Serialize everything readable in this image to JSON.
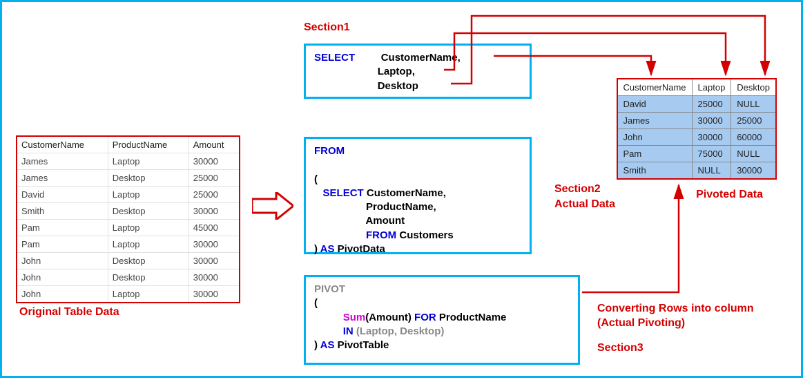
{
  "labels": {
    "section1": "Section1",
    "section2a": "Section2",
    "section2b": "Actual Data",
    "section3_line1": "Converting Rows into column",
    "section3_line2": "(Actual Pivoting)",
    "section3": "Section3",
    "original": "Original Table Data",
    "pivoted": "Pivoted Data"
  },
  "source_table": {
    "headers": [
      "CustomerName",
      "ProductName",
      "Amount"
    ],
    "rows": [
      [
        "James",
        "Laptop",
        "30000"
      ],
      [
        "James",
        "Desktop",
        "25000"
      ],
      [
        "David",
        "Laptop",
        "25000"
      ],
      [
        "Smith",
        "Desktop",
        "30000"
      ],
      [
        "Pam",
        "Laptop",
        "45000"
      ],
      [
        "Pam",
        "Laptop",
        "30000"
      ],
      [
        "John",
        "Desktop",
        "30000"
      ],
      [
        "John",
        "Desktop",
        "30000"
      ],
      [
        "John",
        "Laptop",
        "30000"
      ]
    ]
  },
  "pivot_table": {
    "headers": [
      "CustomerName",
      "Laptop",
      "Desktop"
    ],
    "rows": [
      [
        "David",
        "25000",
        "NULL"
      ],
      [
        "James",
        "30000",
        "25000"
      ],
      [
        "John",
        "30000",
        "60000"
      ],
      [
        "Pam",
        "75000",
        "NULL"
      ],
      [
        "Smith",
        "NULL",
        "30000"
      ]
    ]
  },
  "code": {
    "box1": {
      "keyword": "SELECT",
      "col1": "CustomerName",
      "col2": "Laptop",
      "col3": "Desktop"
    },
    "box2": {
      "from": "FROM",
      "open": "(",
      "select": "SELECT",
      "c1": "CustomerName",
      "c2": "ProductName",
      "c3": "Amount",
      "from2": "FROM",
      "tbl": "Customers",
      "close": ")",
      "as": "AS",
      "alias": "PivotData"
    },
    "box3": {
      "pivot": "PIVOT",
      "open": "(",
      "sum": "Sum",
      "sumargs": "(Amount)",
      "for": "FOR",
      "forcol": "ProductName",
      "in": "IN",
      "inlist": "(Laptop, Desktop)",
      "close": ")",
      "as": "AS",
      "alias": "PivotTable"
    }
  }
}
